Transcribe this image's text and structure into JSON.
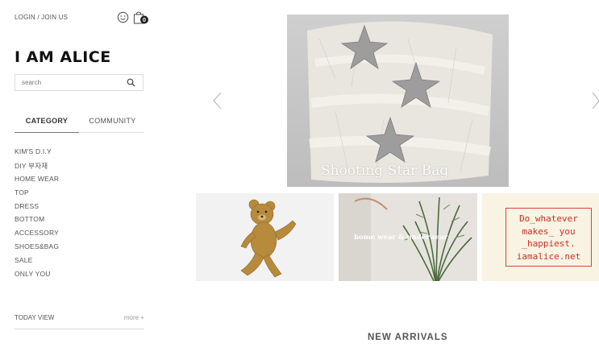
{
  "header": {
    "login_join": "LOGIN / JOIN US",
    "cart_count": "0",
    "logo": "I AM ALICE"
  },
  "search": {
    "placeholder": "search"
  },
  "tabs": [
    {
      "label": "CATEGORY",
      "active": true
    },
    {
      "label": "COMMUNITY",
      "active": false
    }
  ],
  "categories": [
    "KIM'S D.I.Y",
    "DIY 부자재",
    "HOME WEAR",
    "TOP",
    "DRESS",
    "BOTTOM",
    "ACCESSORY",
    "SHOES&BAG",
    "SALE",
    "ONLY YOU"
  ],
  "today_view": {
    "label": "TODAY VIEW",
    "more": "more +"
  },
  "hero": {
    "caption": "Shooting Star Bag"
  },
  "banners": {
    "home_wear_caption": "home wear & underwear",
    "quote_lines": [
      "Do_whatever",
      "makes_ you",
      "_happiest.",
      "iamalice.net"
    ]
  },
  "section": {
    "new_arrivals": "NEW ARRIVALS"
  },
  "icons": {
    "smile": "smile-icon",
    "bag": "shopping-bag-icon",
    "search": "search-icon",
    "prev": "chevron-left-icon",
    "next": "chevron-right-icon"
  },
  "colors": {
    "quote_red": "#c93028",
    "text": "#333333",
    "divider": "#dcdcdc"
  }
}
